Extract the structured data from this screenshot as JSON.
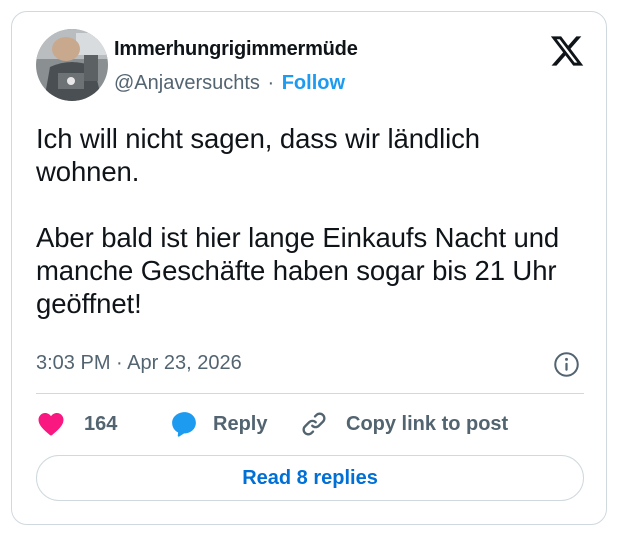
{
  "author": {
    "display_name": "Immerhungrigimmermüde",
    "handle": "@Anjaversuchts",
    "separator": "·",
    "follow_label": "Follow",
    "avatar_icon": "profile-photo"
  },
  "platform": {
    "logo_icon": "x-logo-icon"
  },
  "tweet": {
    "text": "Ich will nicht sagen, dass wir ländlich wohnen.\n\nAber bald ist hier lange Einkaufs Nacht und manche Geschäfte haben sogar bis 21 Uhr geöffnet!"
  },
  "meta": {
    "time": "3:03 PM",
    "separator": "·",
    "date": "Apr 23, 2026",
    "info_icon": "info-icon"
  },
  "actions": {
    "like_count": "164",
    "reply_label": "Reply",
    "copy_label": "Copy link to post"
  },
  "footer": {
    "read_replies_label": "Read 8 replies"
  },
  "colors": {
    "heart": "#f91880",
    "reply_bubble": "#1d9bf0",
    "link_blue": "#1d9bf0",
    "button_text": "#006fd6",
    "secondary_text": "#536471",
    "border": "#cfd9de"
  }
}
